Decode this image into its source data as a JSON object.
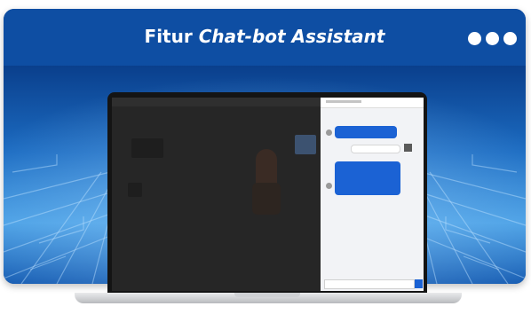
{
  "header": {
    "title_plain": "Fitur ",
    "title_italic": "Chat-bot Assistant",
    "menu_icon": "more-dots-icon"
  },
  "colors": {
    "header_bg": "#0e4ea3",
    "accent": "#1b62d4",
    "text_light": "#ffffff"
  },
  "illustration": {
    "device": "laptop-icon",
    "app_panel": "chat-bot-panel"
  }
}
